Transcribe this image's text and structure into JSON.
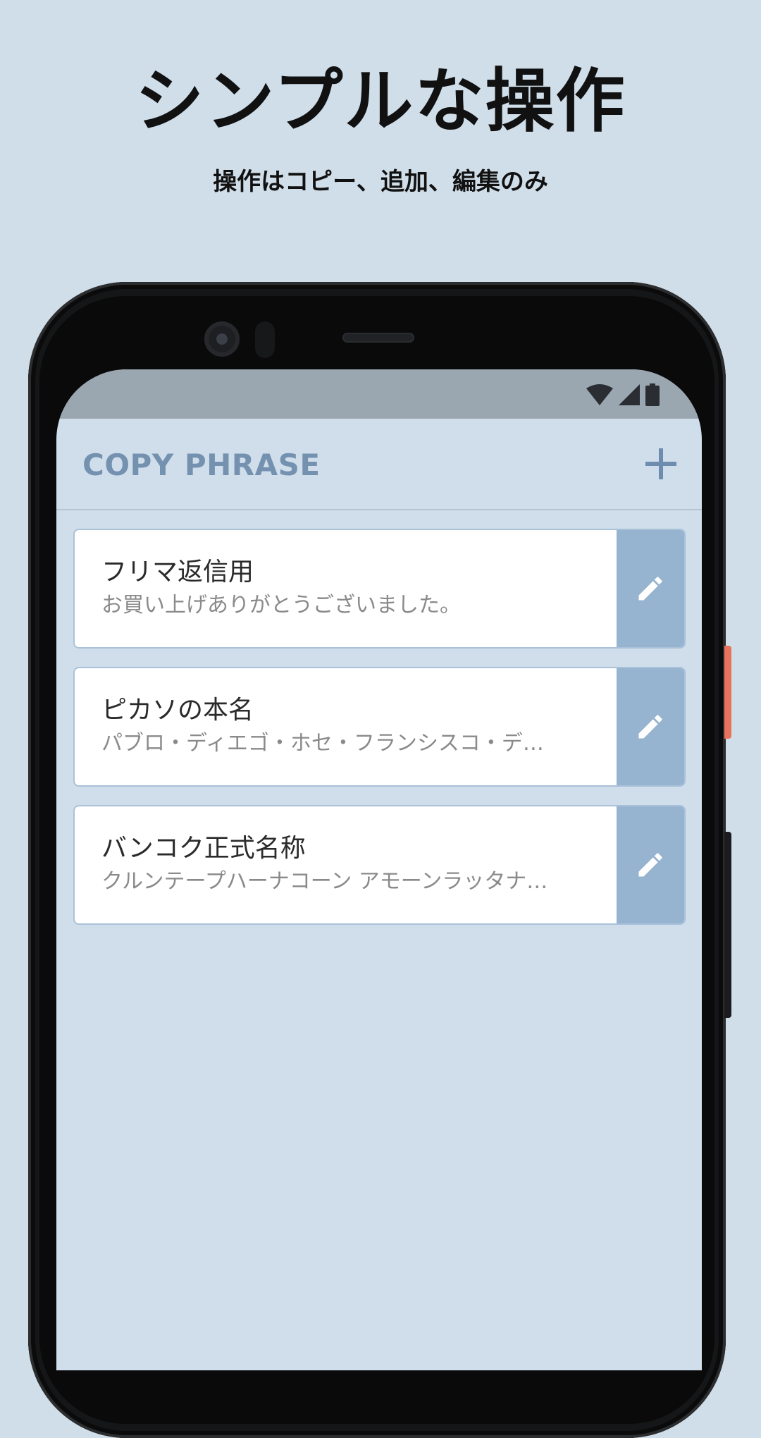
{
  "promo": {
    "headline": "シンプルな操作",
    "subheadline": "操作はコピー、追加、編集のみ"
  },
  "status_bar": {
    "icons": [
      "wifi-icon",
      "signal-icon",
      "battery-icon"
    ]
  },
  "app_bar": {
    "title": "COPY PHRASE",
    "add_icon": "plus-icon"
  },
  "phrases": [
    {
      "title": "フリマ返信用",
      "text": "お買い上げありがとうございました。",
      "edit_icon": "pencil-icon"
    },
    {
      "title": "ピカソの本名",
      "text": "パブロ・ディエゴ・ホセ・フランシスコ・デ…",
      "edit_icon": "pencil-icon"
    },
    {
      "title": "バンコク正式名称",
      "text": "クルンテープハーナコーン アモーンラッタナ…",
      "edit_icon": "pencil-icon"
    }
  ],
  "colors": {
    "page_background": "#d0dee9",
    "status_bar": "#9aa6b0",
    "accent": "#7591b0",
    "edit_button": "#96b3cf",
    "card_border": "#a9c1d9"
  }
}
